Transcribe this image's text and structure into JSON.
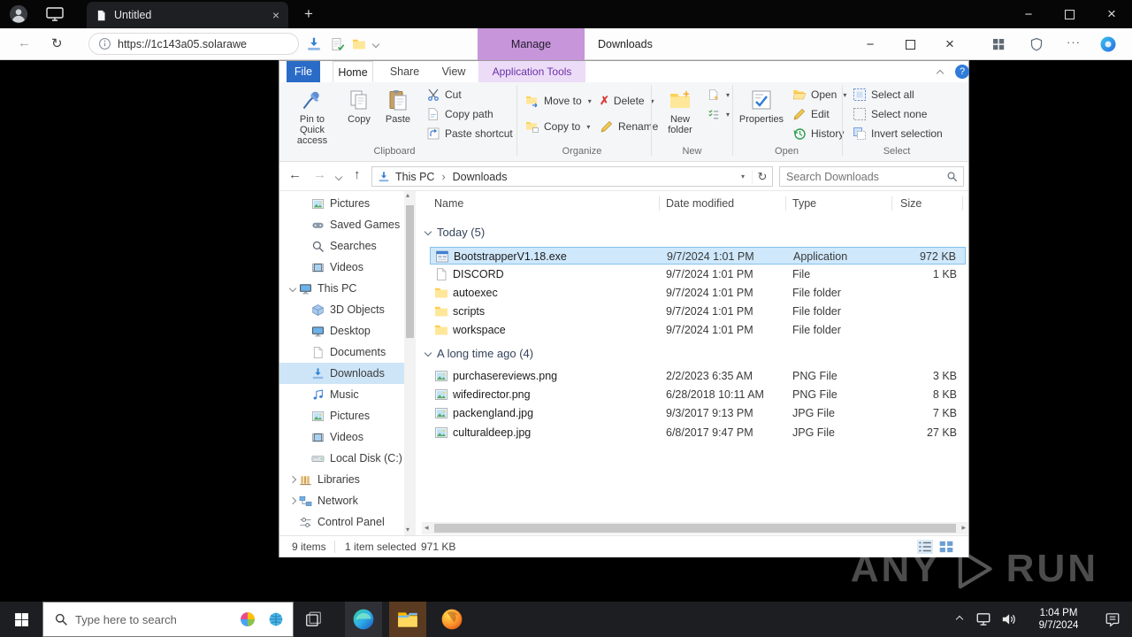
{
  "browser": {
    "tab_title": "Untitled",
    "url": "https://1c143a05.solarawe"
  },
  "explorer": {
    "title": "Downloads",
    "contextual_label": "Manage",
    "tabs": [
      {
        "label": "File"
      },
      {
        "label": "Home"
      },
      {
        "label": "Share"
      },
      {
        "label": "View"
      },
      {
        "label": "Application Tools"
      }
    ],
    "ribbon": {
      "clipboard": {
        "label": "Clipboard",
        "pin": "Pin to Quick access",
        "copy": "Copy",
        "paste": "Paste",
        "cut": "Cut",
        "copy_path": "Copy path",
        "paste_shortcut": "Paste shortcut"
      },
      "organize": {
        "label": "Organize",
        "move_to": "Move to",
        "copy_to": "Copy to",
        "delete": "Delete",
        "rename": "Rename"
      },
      "new_group": {
        "label": "New",
        "new_folder": "New folder"
      },
      "open_group": {
        "label": "Open",
        "properties": "Properties",
        "open": "Open",
        "edit": "Edit",
        "history": "History"
      },
      "select_group": {
        "label": "Select",
        "select_all": "Select all",
        "select_none": "Select none",
        "invert_selection": "Invert selection"
      }
    },
    "address": {
      "crumb1": "This PC",
      "crumb2": "Downloads"
    },
    "search_placeholder": "Search Downloads",
    "columns": {
      "name": "Name",
      "date": "Date modified",
      "type": "Type",
      "size": "Size"
    },
    "nav": {
      "items": [
        {
          "label": "Pictures"
        },
        {
          "label": "Saved Games"
        },
        {
          "label": "Searches"
        },
        {
          "label": "Videos"
        },
        {
          "label": "This PC"
        },
        {
          "label": "3D Objects"
        },
        {
          "label": "Desktop"
        },
        {
          "label": "Documents"
        },
        {
          "label": "Downloads"
        },
        {
          "label": "Music"
        },
        {
          "label": "Pictures"
        },
        {
          "label": "Videos"
        },
        {
          "label": "Local Disk (C:)"
        },
        {
          "label": "Libraries"
        },
        {
          "label": "Network"
        },
        {
          "label": "Control Panel"
        }
      ]
    },
    "groups": [
      {
        "label": "Today (5)",
        "items": [
          {
            "name": "BootstrapperV1.18.exe",
            "date": "9/7/2024 1:01 PM",
            "type": "Application",
            "size": "972 KB"
          },
          {
            "name": "DISCORD",
            "date": "9/7/2024 1:01 PM",
            "type": "File",
            "size": "1 KB"
          },
          {
            "name": "autoexec",
            "date": "9/7/2024 1:01 PM",
            "type": "File folder",
            "size": ""
          },
          {
            "name": "scripts",
            "date": "9/7/2024 1:01 PM",
            "type": "File folder",
            "size": ""
          },
          {
            "name": "workspace",
            "date": "9/7/2024 1:01 PM",
            "type": "File folder",
            "size": ""
          }
        ]
      },
      {
        "label": "A long time ago (4)",
        "items": [
          {
            "name": "purchasereviews.png",
            "date": "2/2/2023 6:35 AM",
            "type": "PNG File",
            "size": "3 KB"
          },
          {
            "name": "wifedirector.png",
            "date": "6/28/2018 10:11 AM",
            "type": "PNG File",
            "size": "8 KB"
          },
          {
            "name": "packengland.jpg",
            "date": "9/3/2017 9:13 PM",
            "type": "JPG File",
            "size": "7 KB"
          },
          {
            "name": "culturaldeep.jpg",
            "date": "6/8/2017 9:47 PM",
            "type": "JPG File",
            "size": "27 KB"
          }
        ]
      }
    ],
    "status": {
      "total": "9 items",
      "selected": "1 item selected",
      "size": "971 KB"
    }
  },
  "taskbar": {
    "search_placeholder": "Type here to search",
    "clock": {
      "time": "1:04 PM",
      "date": "9/7/2024"
    }
  },
  "watermark": {
    "left": "ANY",
    "right": "RUN"
  },
  "colors": {
    "selection": "#cfe8fc",
    "contextual_tab": "#c795da",
    "file_tab": "#2a6bc8"
  }
}
